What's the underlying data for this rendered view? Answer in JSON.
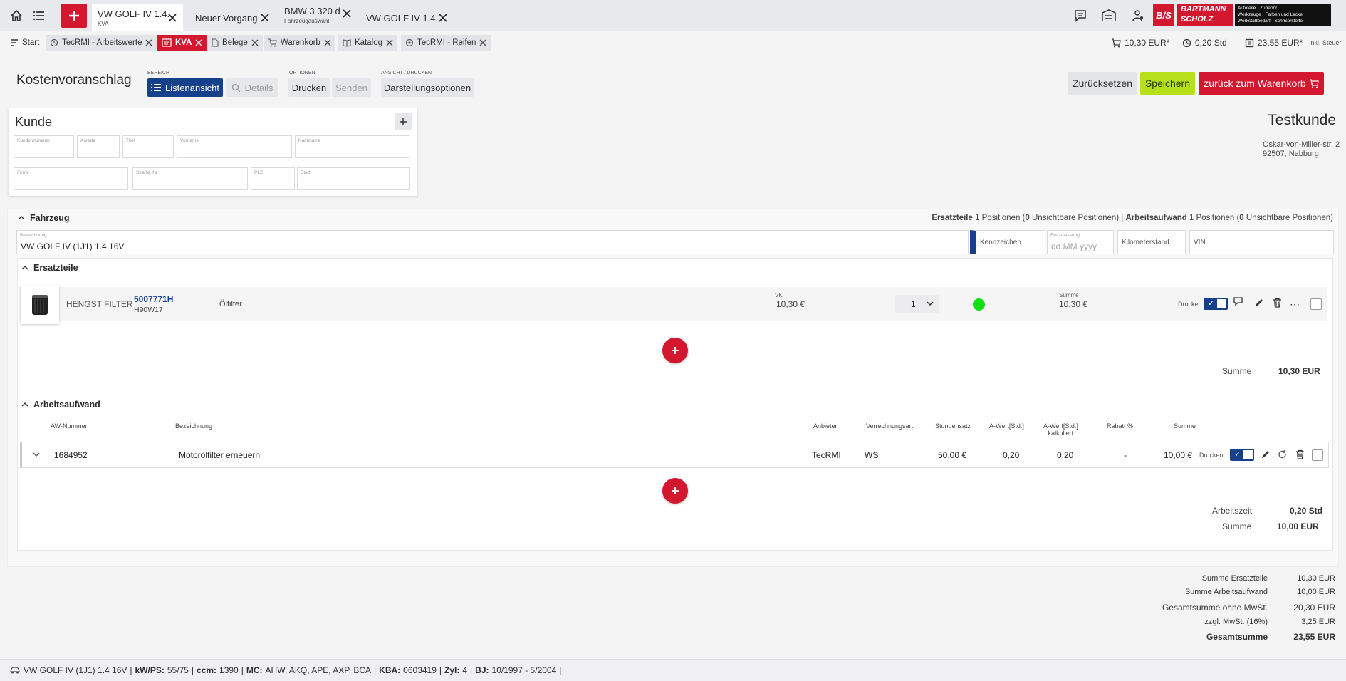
{
  "top": {
    "vehicle_tabs": [
      {
        "title": "VW GOLF IV 1.4...",
        "sub": "KVA"
      },
      {
        "title": "Neuer Vorgang",
        "sub": ""
      },
      {
        "title": "BMW 3 320 d",
        "sub": "Fahrzeugauswahl"
      },
      {
        "title": "VW GOLF IV 1.4...",
        "sub": ""
      }
    ],
    "brand": {
      "logo_mark": "B/S",
      "name1": "BARTMANN",
      "name2": "SCHOLZ",
      "tag1": "Autoteile · Zubehör",
      "tag2": "Werkzeuge · Farben und Lacke",
      "tag3": "Werkstattbedarf · Schmierstoffe"
    }
  },
  "module_tabs": [
    {
      "label": "Start"
    },
    {
      "label": "TecRMI - Arbeitswerte"
    },
    {
      "label": "KVA"
    },
    {
      "label": "Belege"
    },
    {
      "label": "Warenkorb"
    },
    {
      "label": "Katalog"
    },
    {
      "label": "TecRMI - Reifen"
    }
  ],
  "cart_totals": {
    "cart": "10,30 EUR*",
    "time": "0,20 Std",
    "total": "23,55 EUR*",
    "tax_note": "inkl. Steuer"
  },
  "header": {
    "title": "Kostenvoranschlag",
    "bereich_label": "BEREICH",
    "view_list": "Listenansicht",
    "view_details": "Details",
    "optionen_label": "OPTIONEN",
    "print": "Drucken",
    "send": "Senden",
    "ansicht_label": "ANSICHT / DRUCKEN",
    "display_options": "Darstellungsoptionen",
    "reset": "Zurücksetzen",
    "save": "Speichern",
    "back_to_cart": "zurück zum Warenkorb"
  },
  "customer": {
    "heading": "Kunde",
    "fields": [
      "Kundennummer",
      "Anrede",
      "Titel",
      "Vorname",
      "Nachname",
      "Firma",
      "Straße, Nr.",
      "PLZ",
      "Stadt"
    ],
    "name": "Testkunde",
    "street": "Oskar-von-Miller-str. 2",
    "city": "92507, Nabburg"
  },
  "vehicle": {
    "heading": "Fahrzeug",
    "summary_parts_label": "Ersatzteile",
    "summary_parts_a": "1 Positionen (",
    "summary_parts_b": "0",
    "summary_parts_c": " Unsichtbare Positionen)",
    "summary_sep": "|",
    "summary_work_label": "Arbeitsaufwand",
    "summary_work_a": "1 Positionen (",
    "summary_work_b": "0",
    "summary_work_c": " Unsichtbare Positionen)",
    "desc_label": "Bezeichnung",
    "desc_value": "VW GOLF IV (1J1) 1.4 16V",
    "plate": "Kennzeichen",
    "reg_label": "Erstzulassung",
    "reg_placeholder": "dd.MM.yyyy",
    "km": "Kilometerstand",
    "vin": "VIN"
  },
  "parts": {
    "heading": "Ersatzteile",
    "items": [
      {
        "brand": "HENGST FILTER",
        "number": "5007771H",
        "alt": "H90W17",
        "desc": "Ölfilter",
        "vk_label": "VK",
        "vk": "10,30 €",
        "qty": "1",
        "sum_label": "Summe",
        "sum": "10,30 €",
        "print_label": "Drucken"
      }
    ],
    "total_label": "Summe",
    "total": "10,30 EUR"
  },
  "work": {
    "heading": "Arbeitsaufwand",
    "columns": {
      "aw": "AW-Nummer",
      "desc": "Bezeichnung",
      "provider": "Anbieter",
      "billing": "Verrechnungsart",
      "rate": "Stundensatz",
      "aval": "A-Wert[Std.]",
      "aval_calc1": "A-Wert[Std.]",
      "aval_calc2": "kalkuliert",
      "discount": "Rabatt %",
      "sum": "Summe"
    },
    "items": [
      {
        "aw": "1684952",
        "desc": "Motorölfilter erneuern",
        "provider": "TecRMI",
        "billing": "WS",
        "rate": "50,00 €",
        "aval": "0,20",
        "aval_calc": "0,20",
        "discount": "-",
        "sum": "10,00 €",
        "print_label": "Drucken"
      }
    ],
    "time_label": "Arbeitszeit",
    "time": "0,20 Std",
    "total_label": "Summe",
    "total": "10,00 EUR"
  },
  "summary": [
    {
      "label": "Summe Ersatzteile",
      "value": "10,30 EUR"
    },
    {
      "label": "Summe Arbeitsaufwand",
      "value": "10,00 EUR"
    },
    {
      "label": "Gesamtsumme ohne MwSt.",
      "value": "20,30 EUR"
    },
    {
      "label": "zzgl. MwSt. (16%)",
      "value": "3,25 EUR"
    },
    {
      "label": "Gesamtsumme",
      "value": "23,55 EUR"
    }
  ],
  "footer": {
    "car": "VW GOLF IV (1J1) 1.4 16V",
    "kwps_label": "kW/PS:",
    "kwps": "55/75",
    "ccm_label": "ccm:",
    "ccm": "1390",
    "mc_label": "MC:",
    "mc": "AHW, AKQ, APE, AXP, BCA",
    "kba_label": "KBA:",
    "kba": "0603419",
    "zyl_label": "Zyl:",
    "zyl": "4",
    "bj_label": "BJ:",
    "bj": "10/1997 - 5/2004"
  },
  "colors": {
    "accent_red": "#d3172e",
    "save_green": "#b8e01a",
    "navy": "#17408b",
    "status_green": "#11e011"
  }
}
